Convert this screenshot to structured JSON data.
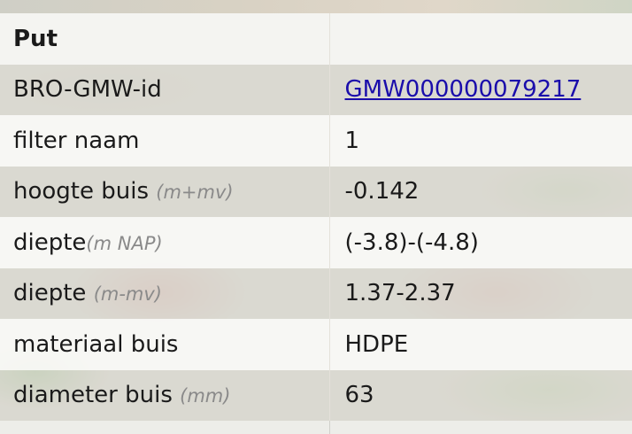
{
  "table": {
    "header": {
      "label": "Put",
      "value": ""
    },
    "rows": [
      {
        "label": "BRO-GMW-id",
        "unit": "",
        "value": "GMW000000079217",
        "link": true
      },
      {
        "label": "filter naam",
        "unit": "",
        "value": "1"
      },
      {
        "label": "hoogte buis",
        "unit": "(m+mv)",
        "value": "-0.142"
      },
      {
        "label": "diepte",
        "unit": "(m NAP)",
        "value": "(-3.8)-(-4.8)"
      },
      {
        "label": "diepte",
        "unit": "(m-mv)",
        "value": "1.37-2.37"
      },
      {
        "label": "materiaal buis",
        "unit": "",
        "value": "HDPE"
      },
      {
        "label": "diameter buis",
        "unit": "(mm)",
        "value": "63"
      }
    ]
  },
  "colors": {
    "link": "#1a0dab",
    "unit": "#8a8a8a"
  }
}
